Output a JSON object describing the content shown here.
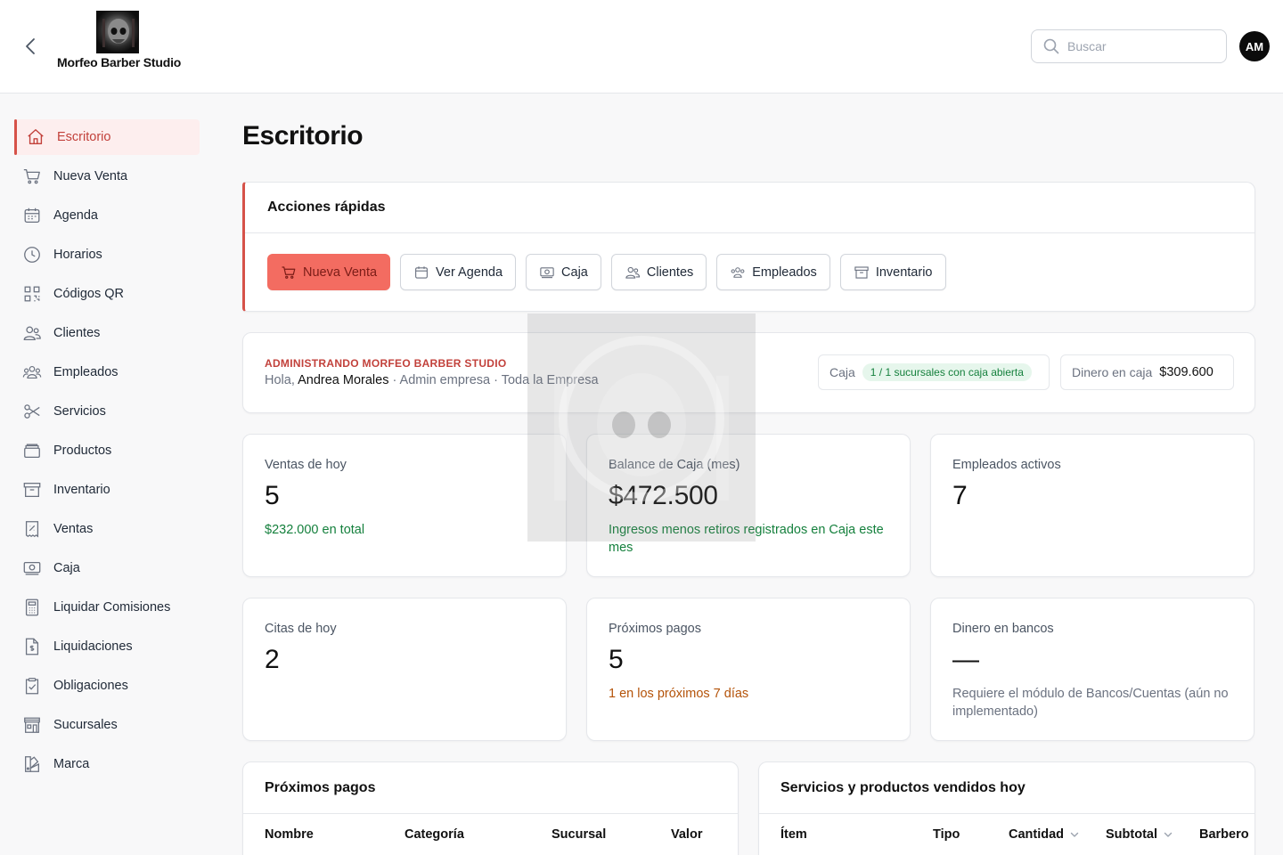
{
  "header": {
    "brand_name": "Morfeo Barber Studio",
    "search_placeholder": "Buscar",
    "avatar_initials": "AM"
  },
  "sidebar": {
    "items": [
      {
        "label": "Escritorio",
        "icon": "home-icon",
        "active": true
      },
      {
        "label": "Nueva Venta",
        "icon": "cart-icon"
      },
      {
        "label": "Agenda",
        "icon": "calendar-icon"
      },
      {
        "label": "Horarios",
        "icon": "clock-icon"
      },
      {
        "label": "Códigos QR",
        "icon": "qr-code-icon"
      },
      {
        "label": "Clientes",
        "icon": "users-icon"
      },
      {
        "label": "Empleados",
        "icon": "user-group-icon"
      },
      {
        "label": "Servicios",
        "icon": "scissors-icon"
      },
      {
        "label": "Productos",
        "icon": "box-icon"
      },
      {
        "label": "Inventario",
        "icon": "archive-icon"
      },
      {
        "label": "Ventas",
        "icon": "receipt-icon"
      },
      {
        "label": "Caja",
        "icon": "cash-icon"
      },
      {
        "label": "Liquidar Comisiones",
        "icon": "calculator-icon"
      },
      {
        "label": "Liquidaciones",
        "icon": "document-dollar-icon"
      },
      {
        "label": "Obligaciones",
        "icon": "clipboard-check-icon"
      },
      {
        "label": "Sucursales",
        "icon": "store-icon"
      },
      {
        "label": "Marca",
        "icon": "palette-icon"
      }
    ]
  },
  "page": {
    "title": "Escritorio"
  },
  "quick_actions": {
    "title": "Acciones rápidas",
    "buttons": [
      {
        "label": "Nueva Venta",
        "icon": "cart-icon",
        "primary": true
      },
      {
        "label": "Ver Agenda",
        "icon": "calendar-icon"
      },
      {
        "label": "Caja",
        "icon": "cash-icon"
      },
      {
        "label": "Clientes",
        "icon": "users-icon"
      },
      {
        "label": "Empleados",
        "icon": "user-group-icon"
      },
      {
        "label": "Inventario",
        "icon": "archive-icon"
      }
    ]
  },
  "admin": {
    "kicker": "ADMINISTRANDO MORFEO BARBER STUDIO",
    "greeting": "Hola,",
    "user_name": "Andrea Morales",
    "role_scope": "· Admin empresa · Toda la Empresa",
    "caja_label": "Caja",
    "caja_badge": "1 / 1 sucursales con caja abierta",
    "dinero_label": "Dinero en caja",
    "dinero_value": "$309.600"
  },
  "stats": [
    {
      "label": "Ventas de hoy",
      "value": "5",
      "note": "$232.000 en total",
      "note_color": "green"
    },
    {
      "label": "Balance de Caja (mes)",
      "value": "$472.500",
      "note": "Ingresos menos retiros registrados en Caja este mes",
      "note_color": "green"
    },
    {
      "label": "Empleados activos",
      "value": "7",
      "note": "",
      "note_color": "gray"
    },
    {
      "label": "Citas de hoy",
      "value": "2",
      "note": "",
      "note_color": "gray"
    },
    {
      "label": "Próximos pagos",
      "value": "5",
      "note": "1 en los próximos 7 días",
      "note_color": "orange"
    },
    {
      "label": "Dinero en bancos",
      "value": "—",
      "note": "Requiere el módulo de Bancos/Cuentas (aún no implementado)",
      "note_color": "gray"
    }
  ],
  "upcoming_payments": {
    "title": "Próximos pagos",
    "columns": [
      "Nombre",
      "Categoría",
      "Sucursal",
      "Valor"
    ]
  },
  "sold_today": {
    "title": "Servicios y productos vendidos hoy",
    "columns": [
      "Ítem",
      "Tipo",
      "Cantidad",
      "Subtotal",
      "Barbero"
    ]
  },
  "colors": {
    "accent": "#d65249",
    "primary_button": "#f36c61",
    "success": "#15803d",
    "warning": "#b45309"
  }
}
